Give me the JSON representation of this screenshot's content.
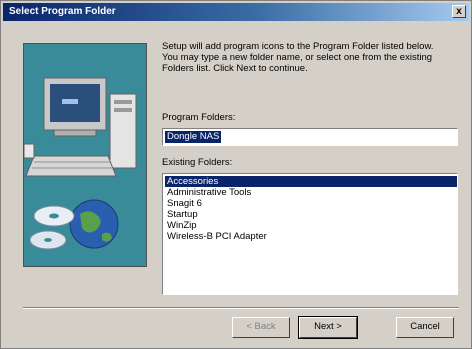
{
  "window": {
    "title": "Select Program Folder",
    "close_label": "x"
  },
  "intro": {
    "line1": "Setup will add program icons to the Program Folder listed below.",
    "line2": "You may type a new folder name, or select one from the existing",
    "line3": "Folders list.  Click Next to continue."
  },
  "program_folders": {
    "label": "Program Folders:",
    "value": "Dongle NAS"
  },
  "existing_folders": {
    "label": "Existing Folders:",
    "items": [
      "Accessories",
      "Administrative Tools",
      "Snagit 6",
      "Startup",
      "WinZip",
      "Wireless-B PCI Adapter"
    ],
    "selected_index": 0
  },
  "buttons": {
    "back": "< Back",
    "next": "Next >",
    "cancel": "Cancel"
  },
  "colors": {
    "title_bar_start": "#0a246a",
    "title_bar_end": "#a6caf0",
    "dialog_face": "#d4d0c8",
    "selection": "#0a246a",
    "art_background": "#3a8b9a"
  }
}
